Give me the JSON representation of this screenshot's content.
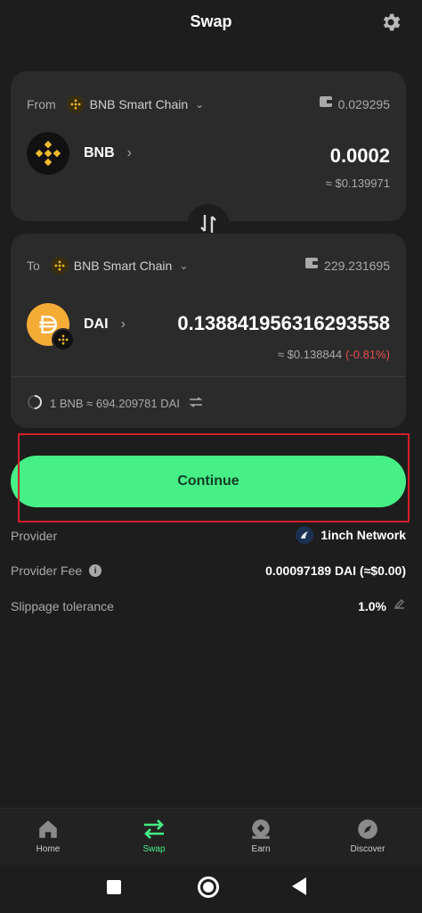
{
  "header": {
    "title": "Swap",
    "settings_icon": "gear-icon"
  },
  "from": {
    "label": "From",
    "chain": "BNB Smart Chain",
    "balance": "0.029295",
    "token": "BNB",
    "amount": "0.0002",
    "usd_value": "≈ $0.139971"
  },
  "to": {
    "label": "To",
    "chain": "BNB Smart Chain",
    "balance": "229.231695",
    "token": "DAI",
    "amount": "0.138841956316293558",
    "usd_value": "≈ $0.138844",
    "change": "(-0.81%)",
    "change_color": "#e74c4c"
  },
  "rate": {
    "text": "1 BNB ≈ 694.209781 DAI"
  },
  "continue_button": {
    "label": "Continue",
    "color": "#46f087"
  },
  "details": {
    "provider_label": "Provider",
    "provider_value": "1inch Network",
    "fee_label": "Provider Fee",
    "fee_value": "0.00097189 DAI (≈$0.00)",
    "slippage_label": "Slippage tolerance",
    "slippage_value": "1.0%"
  },
  "bottom_nav": {
    "home": "Home",
    "swap": "Swap",
    "earn": "Earn",
    "discover": "Discover",
    "active": "Swap",
    "active_color": "#46f087"
  }
}
